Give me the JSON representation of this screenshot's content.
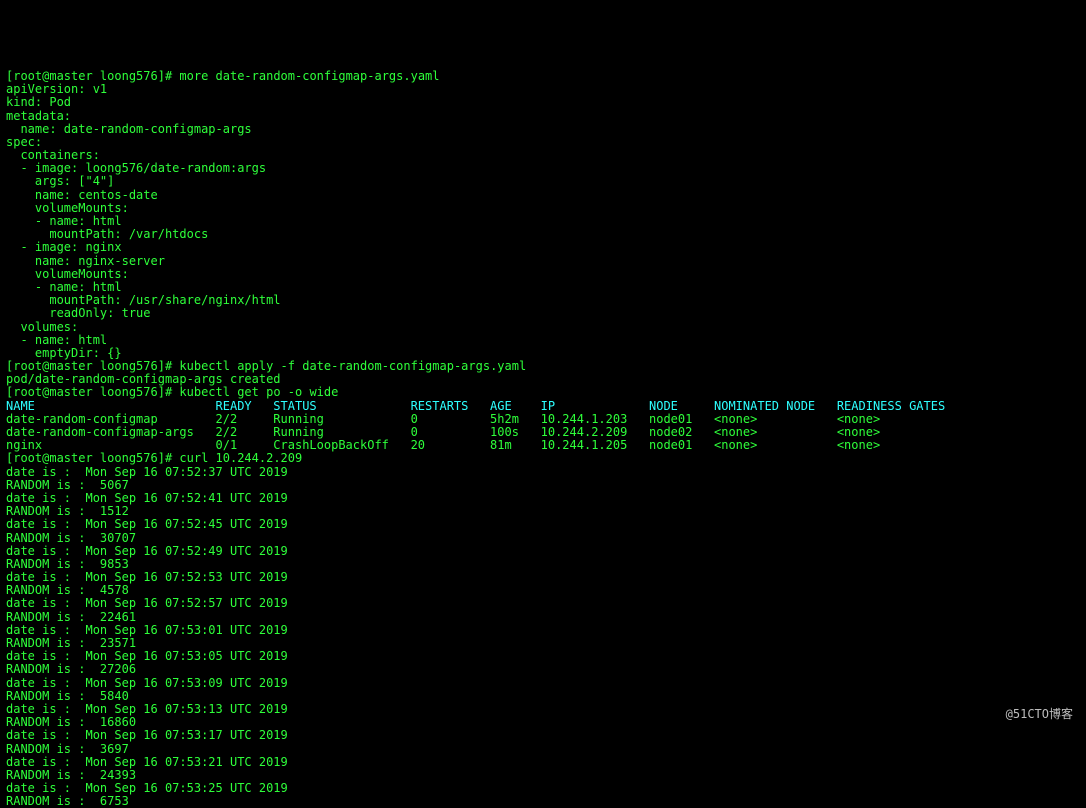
{
  "prompt": "[root@master loong576]#",
  "cmd_more": "more date-random-configmap-args.yaml",
  "yaml": {
    "l01": "apiVersion: v1",
    "l02": "kind: Pod",
    "l03": "metadata:",
    "l04": "  name: date-random-configmap-args",
    "l05": "spec:",
    "l06": "  containers:",
    "l07": "  - image: loong576/date-random:args",
    "l08": "    args: [\"4\"]",
    "l09": "    name: centos-date",
    "l10": "    volumeMounts:",
    "l11": "    - name: html",
    "l12": "      mountPath: /var/htdocs",
    "l13": "  - image: nginx",
    "l14": "    name: nginx-server",
    "l15": "    volumeMounts:",
    "l16": "    - name: html",
    "l17": "      mountPath: /usr/share/nginx/html",
    "l18": "      readOnly: true",
    "l19": "  volumes:",
    "l20": "  - name: html",
    "l21": "    emptyDir: {}"
  },
  "cmd_apply": "kubectl apply -f date-random-configmap-args.yaml",
  "apply_result": "pod/date-random-configmap-args created",
  "cmd_get": "kubectl get po -o wide",
  "table_header": "NAME                         READY   STATUS             RESTARTS   AGE    IP             NODE     NOMINATED NODE   READINESS GATES",
  "table_rows": [
    "date-random-configmap        2/2     Running            0          5h2m   10.244.1.203   node01   <none>           <none>",
    "date-random-configmap-args   2/2     Running            0          100s   10.244.2.209   node02   <none>           <none>",
    "nginx                        0/1     CrashLoopBackOff   20         81m    10.244.1.205   node01   <none>           <none>"
  ],
  "cmd_curl": "curl 10.244.2.209",
  "curl_output": [
    "date is :  Mon Sep 16 07:52:37 UTC 2019",
    "RANDOM is :  5067",
    "date is :  Mon Sep 16 07:52:41 UTC 2019",
    "RANDOM is :  1512",
    "date is :  Mon Sep 16 07:52:45 UTC 2019",
    "RANDOM is :  30707",
    "date is :  Mon Sep 16 07:52:49 UTC 2019",
    "RANDOM is :  9853",
    "date is :  Mon Sep 16 07:52:53 UTC 2019",
    "RANDOM is :  4578",
    "date is :  Mon Sep 16 07:52:57 UTC 2019",
    "RANDOM is :  22461",
    "date is :  Mon Sep 16 07:53:01 UTC 2019",
    "RANDOM is :  23571",
    "date is :  Mon Sep 16 07:53:05 UTC 2019",
    "RANDOM is :  27206",
    "date is :  Mon Sep 16 07:53:09 UTC 2019",
    "RANDOM is :  5840",
    "date is :  Mon Sep 16 07:53:13 UTC 2019",
    "RANDOM is :  16860",
    "date is :  Mon Sep 16 07:53:17 UTC 2019",
    "RANDOM is :  3697",
    "date is :  Mon Sep 16 07:53:21 UTC 2019",
    "RANDOM is :  24393",
    "date is :  Mon Sep 16 07:53:25 UTC 2019",
    "RANDOM is :  6753"
  ],
  "watermark": "@51CTO博客"
}
